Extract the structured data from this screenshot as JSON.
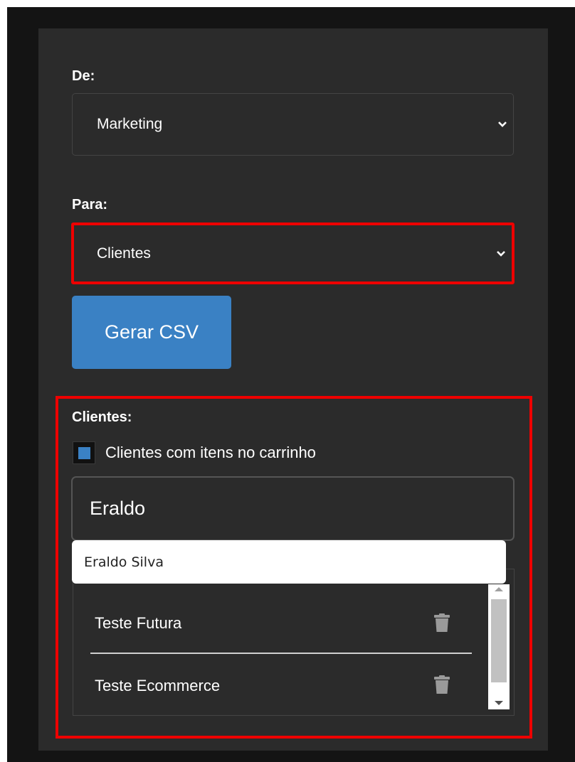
{
  "from": {
    "label": "De:",
    "selected": "Marketing"
  },
  "to": {
    "label": "Para:",
    "selected": "Clientes"
  },
  "generate_button": {
    "label": "Gerar CSV"
  },
  "clients": {
    "label": "Clientes:",
    "checkbox_label": "Clientes com itens no carrinho",
    "checkbox_checked": true,
    "search_value": "Eraldo",
    "suggestion": "Eraldo Silva",
    "items": [
      {
        "name": "Teste Futura"
      },
      {
        "name": "Teste Ecommerce"
      }
    ]
  },
  "colors": {
    "accent": "#3a81c4",
    "highlight": "#ee0000",
    "panel": "#2b2b2b"
  }
}
